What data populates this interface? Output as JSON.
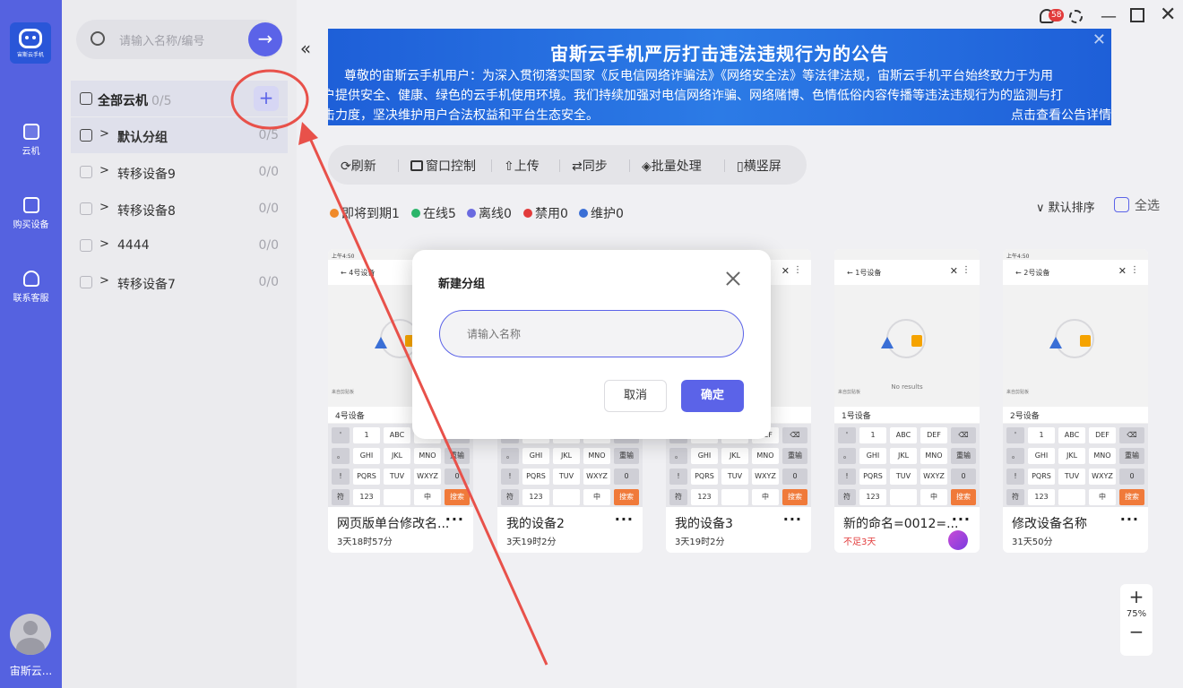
{
  "nav": {
    "brand": "宙斯云手机",
    "items": [
      {
        "label": "云机"
      },
      {
        "label": "购买设备"
      },
      {
        "label": "联系客服"
      }
    ],
    "username": "宙斯云..."
  },
  "search": {
    "placeholder": "请输入名称/编号"
  },
  "groups": {
    "all": {
      "label": "全部云机",
      "count": "0/5"
    },
    "items": [
      {
        "name": "默认分组",
        "count": "0/5"
      },
      {
        "name": "转移设备9",
        "count": "0/0"
      },
      {
        "name": "转移设备8",
        "count": "0/0"
      },
      {
        "name": "4444",
        "count": "0/0"
      },
      {
        "name": "转移设备7",
        "count": "0/0"
      }
    ]
  },
  "notifications": {
    "badge": "58"
  },
  "banner": {
    "title": "宙斯云手机严厉打击违法违规行为的公告",
    "line1": "尊敬的宙斯云手机用户：为深入贯彻落实国家《反电信网络诈骗法》《网络安全法》等法律法规，宙斯云手机平台始终致力于为用",
    "line2": "户提供安全、健康、绿色的云手机使用环境。我们持续加强对电信网络诈骗、网络赌博、色情低俗内容传播等违法违规行为的监测与打",
    "line3": "击力度，坚决维护用户合法权益和平台生态安全。",
    "link": "点击查看公告详情"
  },
  "toolbar": {
    "refresh": "刷新",
    "window": "窗口控制",
    "upload": "上传",
    "sync": "同步",
    "batch": "批量处理",
    "orient": "横竖屏"
  },
  "status": {
    "expiring": "即将到期1",
    "online": "在线5",
    "offline": "离线0",
    "banned": "禁用0",
    "maintain": "维护0",
    "colors": {
      "expiring": "#f08a2a",
      "online": "#2bb56a",
      "offline": "#6a6ae0",
      "banned": "#e23b3b",
      "maintain": "#3a6fd6"
    }
  },
  "sort": {
    "label": "默认排序",
    "select_all": "全选"
  },
  "cards": [
    {
      "header": "4号设备",
      "device_line": "4号设备",
      "name": "网页版单台修改名...",
      "time": "3天18时57分",
      "time_red": false,
      "status_time": "上午4:50"
    },
    {
      "header": "",
      "device_line": "",
      "name": "我的设备2",
      "time": "3天19时2分",
      "time_red": false,
      "status_time": ""
    },
    {
      "header": "",
      "device_line": "",
      "name": "我的设备3",
      "time": "3天19时2分",
      "time_red": false,
      "status_time": ""
    },
    {
      "header": "1号设备",
      "device_line": "1号设备",
      "name": "新的命名=0012=...",
      "time": "不足3天",
      "time_red": true,
      "status_time": "",
      "no_results": "No results"
    },
    {
      "header": "2号设备",
      "device_line": "2号设备",
      "name": "修改设备名称",
      "time": "31天50分",
      "time_red": false,
      "status_time": "上午4:50"
    }
  ],
  "keyboard": {
    "row1": [
      "'",
      "1",
      "ABC",
      "DEF",
      "⌫"
    ],
    "row2": [
      "。",
      "GHI",
      "JKL",
      "MNO",
      "重输"
    ],
    "row3": [
      "!",
      "PQRS",
      "TUV",
      "WXYZ",
      "0"
    ],
    "row4": [
      "符",
      "123",
      "",
      "中",
      "搜索"
    ],
    "clipboard": "来自剪贴板"
  },
  "zoom": {
    "level": "75%",
    "plus": "+",
    "minus": "−"
  },
  "modal": {
    "title": "新建分组",
    "input_placeholder": "请输入名称",
    "cancel": "取消",
    "ok": "确定"
  }
}
